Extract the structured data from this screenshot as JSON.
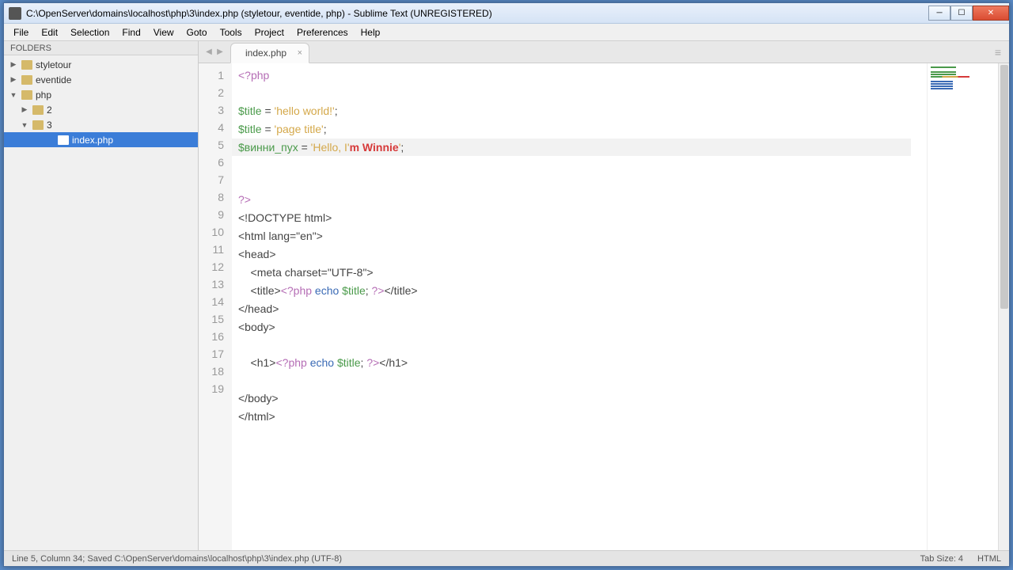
{
  "window": {
    "title": "C:\\OpenServer\\domains\\localhost\\php\\3\\index.php (styletour, eventide, php) - Sublime Text (UNREGISTERED)"
  },
  "menu": {
    "file": "File",
    "edit": "Edit",
    "selection": "Selection",
    "find": "Find",
    "view": "View",
    "goto": "Goto",
    "tools": "Tools",
    "project": "Project",
    "preferences": "Preferences",
    "help": "Help"
  },
  "sidebar": {
    "header": "FOLDERS",
    "items": {
      "styletour": "styletour",
      "eventide": "eventide",
      "php": "php",
      "two": "2",
      "three": "3",
      "indexphp": "index.php"
    }
  },
  "tab": {
    "label": "index.php"
  },
  "line_numbers": [
    "1",
    "2",
    "3",
    "4",
    "5",
    "6",
    "7",
    "8",
    "9",
    "10",
    "11",
    "12",
    "13",
    "14",
    "15",
    "16",
    "17",
    "18",
    "19"
  ],
  "code": {
    "l1": {
      "php_open": "<?php"
    },
    "l3": {
      "var": "$title",
      "eq": " = ",
      "str": "'hello world!'",
      "semi": ";"
    },
    "l4": {
      "var": "$title",
      "eq": " = ",
      "str": "'page title'",
      "semi": ";"
    },
    "l5": {
      "var": "$винни_пух",
      "eq": " = ",
      "str1": "'Hello, I'",
      "err": "m Winnie",
      "str2": "'",
      "semi": ";"
    },
    "l7": {
      "php_close": "?>"
    },
    "l8": "<!DOCTYPE html>",
    "l9": "<html lang=\"en\">",
    "l10": "<head>",
    "l11": "    <meta charset=\"UTF-8\">",
    "l12": {
      "t1": "    <title>",
      "php": "<?php ",
      "kw": "echo ",
      "var": "$title",
      "semi": "; ",
      "close": "?>",
      "t2": "</title>"
    },
    "l13": "</head>",
    "l14": "<body>",
    "l16": {
      "t1": "    <h1>",
      "php": "<?php ",
      "kw": "echo ",
      "var": "$title",
      "semi": "; ",
      "close": "?>",
      "t2": "</h1>"
    },
    "l18": "</body>",
    "l19": "</html>"
  },
  "status": {
    "left": "Line 5, Column 34; Saved C:\\OpenServer\\domains\\localhost\\php\\3\\index.php (UTF-8)",
    "tabsize": "Tab Size: 4",
    "syntax": "HTML"
  }
}
